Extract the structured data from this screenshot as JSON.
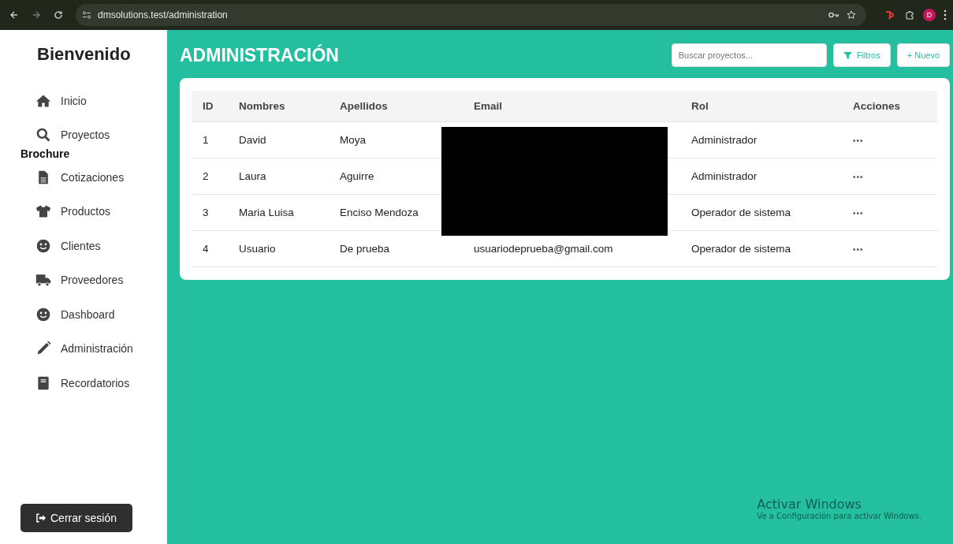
{
  "browser": {
    "url": "dmsolutions.test/administration",
    "profile_initial": "D"
  },
  "sidebar": {
    "title": "Bienvenido",
    "items": [
      {
        "label": "Inicio"
      },
      {
        "label": "Proyectos"
      },
      {
        "label": "Cotizaciones",
        "section": "Brochure"
      },
      {
        "label": "Productos"
      },
      {
        "label": "Clientes"
      },
      {
        "label": "Proveedores"
      },
      {
        "label": "Dashboard"
      },
      {
        "label": "Administración"
      },
      {
        "label": "Recordatorios"
      }
    ],
    "logout": "Cerrar sesión"
  },
  "header": {
    "title": "ADMINISTRACIÓN",
    "search": {
      "placeholder": "Buscar proyectos..."
    },
    "filter_button": "Filtros",
    "new_button": "+ Nuevo"
  },
  "table": {
    "columns": [
      "ID",
      "Nombres",
      "Apellidos",
      "Email",
      "Rol",
      "Acciones"
    ],
    "redacted": true,
    "rows": [
      {
        "id": "1",
        "first": "David",
        "last": "Moya",
        "role": "Administrador",
        "actions": "•••"
      },
      {
        "id": "2",
        "first": "Laura",
        "last": "Aguirre",
        "role": "Administrador",
        "actions": "•••"
      },
      {
        "id": "3",
        "first": "Maria Luisa",
        "last": "Enciso Mendoza",
        "role": "Operador de sistema",
        "actions": "•••"
      },
      {
        "id": "4",
        "first": "Usuario",
        "last": "De prueba",
        "email": "usuariodeprueba@gmail.com",
        "role": "Operador de sistema",
        "actions": "•••"
      }
    ]
  },
  "os_notice": {
    "title": "Activar Windows",
    "text": "Ve a Configuración para activar Windows."
  }
}
